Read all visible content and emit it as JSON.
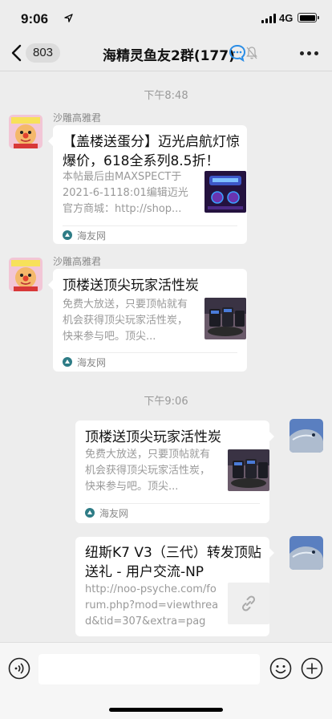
{
  "status": {
    "time": "9:06",
    "network": "4G"
  },
  "nav": {
    "unread_badge": "803",
    "title": "海精灵鱼友2群(177)"
  },
  "messages": [
    {
      "type": "timestamp",
      "text": "下午8:48"
    },
    {
      "type": "card",
      "sender": "沙雕高雅君",
      "title": "【盖楼送蛋分】迈光启航灯惊爆价，618全系列8.5折！",
      "desc": "本帖最后由MAXSPECT于2021-6-1118:01编辑迈光官方商城：http://shop...",
      "source": "海友网"
    },
    {
      "type": "card",
      "sender": "沙雕高雅君",
      "title": "顶楼送顶尖玩家活性炭",
      "desc": "免费大放送，只要顶帖就有机会获得顶尖玩家活性炭，快来参与吧。顶尖...",
      "source": "海友网"
    },
    {
      "type": "timestamp",
      "text": "下午9:06"
    },
    {
      "type": "card",
      "title": "顶楼送顶尖玩家活性炭",
      "desc": "免费大放送，只要顶帖就有机会获得顶尖玩家活性炭，快来参与吧。顶尖...",
      "source": "海友网"
    },
    {
      "type": "link",
      "title": "纽斯K7 V3（三代）转发顶贴送礼 - 用户交流-NP",
      "desc": "http://noo-psyche.com/forum.php?mod=viewthread&tid=307&extra=page..."
    }
  ],
  "colors": {
    "background": "#ededed",
    "card": "#ffffff",
    "meta_text": "#999999",
    "sender_text": "#888888"
  },
  "icons": [
    "location-arrow-icon",
    "signal-icon",
    "battery-icon",
    "back-chevron-icon",
    "chat-bubble-icon",
    "mute-bell-icon",
    "more-icon",
    "source-logo-icon",
    "link-icon",
    "voice-icon",
    "emoji-icon",
    "plus-icon"
  ]
}
